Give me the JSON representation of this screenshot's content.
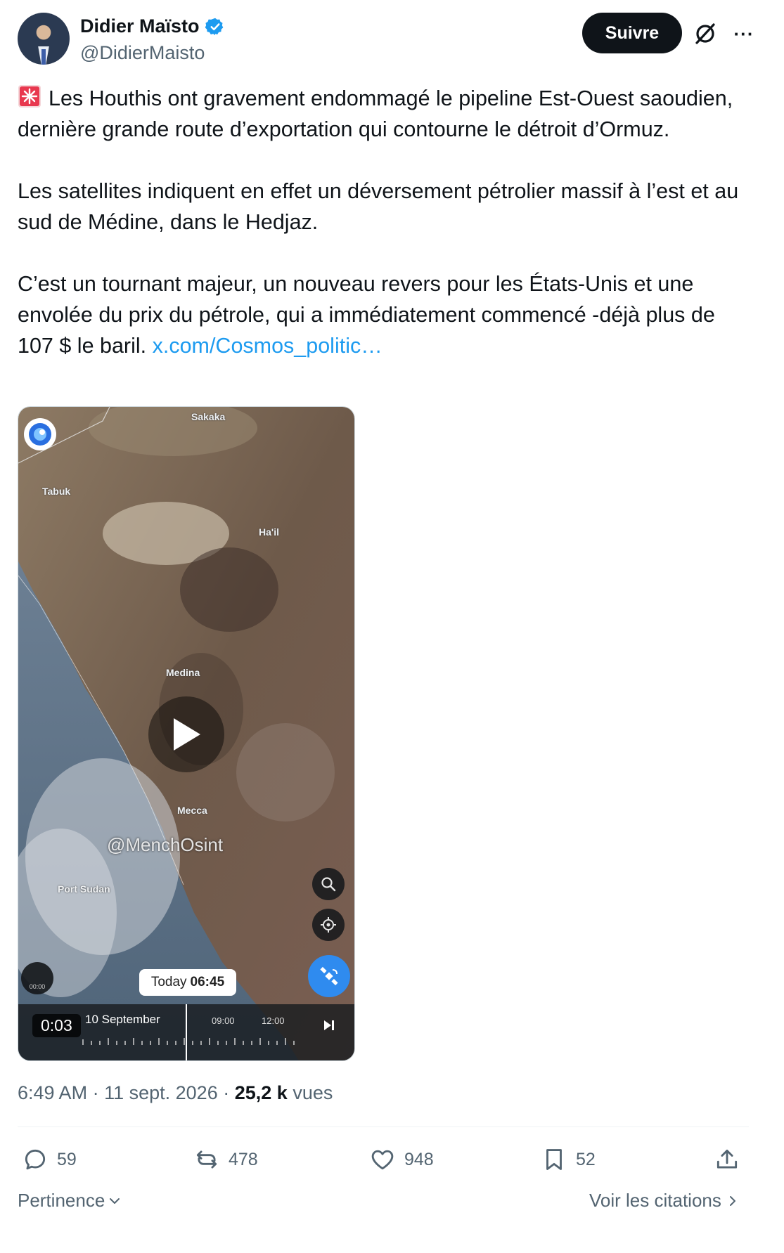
{
  "author": {
    "name": "Didier Maïsto",
    "handle": "@DidierMaisto",
    "verified": true,
    "follow_label": "Suivre"
  },
  "tweet": {
    "paragraphs": [
      "Les Houthis ont gravement endommagé le pipeline Est-Ouest saoudien, dernière grande route d’exportation qui contourne le détroit d’Ormuz.",
      "Les satellites indiquent en effet un déversement pétrolier massif à l’est et au sud de Médine, dans le Hedjaz.",
      "C’est un tournant majeur, un nouveau revers pour les États-Unis et une envolée du prix du pétrole, qui a immédiatement commencé -déjà plus de 107 $ le baril."
    ],
    "link_text": "x.com/Cosmos_politic…",
    "leading_emoji": "siren-icon"
  },
  "media": {
    "map_labels": {
      "sakaka": "Sakaka",
      "tabuk": "Tabuk",
      "hail": "Ha'il",
      "medina": "Medina",
      "mecca": "Mecca",
      "port_sudan": "Port Sudan"
    },
    "watermark": "@MenchOsint",
    "tooltip_prefix": "Today",
    "tooltip_time": "06:45",
    "timeline_date": "10 September",
    "timeline_hour_1": "09:00",
    "timeline_hour_2": "12:00",
    "small_ctrl_label": "00:00",
    "duration": "0:03"
  },
  "meta": {
    "time": "6:49 AM",
    "date": "11 sept. 2026",
    "views_count": "25,2 k",
    "views_label": "vues"
  },
  "actions": {
    "replies": "59",
    "reposts": "478",
    "likes": "948",
    "bookmarks": "52"
  },
  "footer": {
    "sort_label": "Pertinence",
    "quotes_label": "Voir les citations"
  },
  "colors": {
    "link": "#1d9bf0",
    "verified": "#1d9bf0",
    "secondary_text": "#536471",
    "primary_text": "#0f1419"
  }
}
